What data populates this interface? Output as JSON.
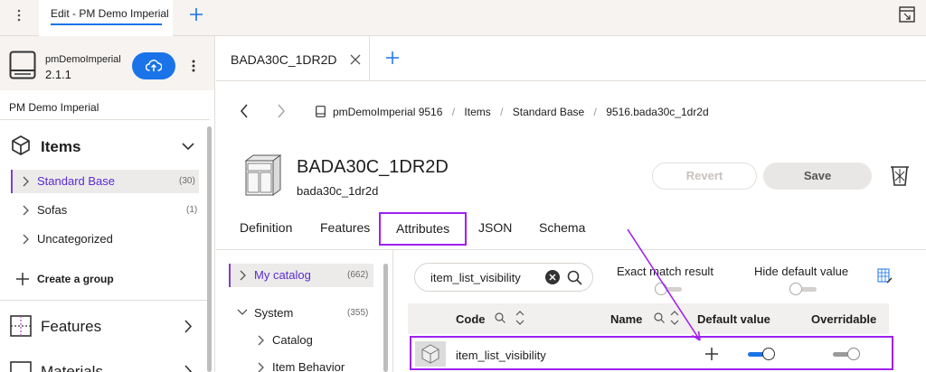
{
  "topbar": {
    "tab_label": "Edit - PM Demo Imperial"
  },
  "project": {
    "name": "pmDemoImperial",
    "version": "2.1.1",
    "title": "PM Demo Imperial"
  },
  "sidebar": {
    "items_heading": "Items",
    "groups": [
      {
        "label": "Standard Base",
        "count": "(30)"
      },
      {
        "label": "Sofas",
        "count": "(1)"
      },
      {
        "label": "Uncategorized",
        "count": ""
      }
    ],
    "create_group": "Create a group",
    "features": "Features",
    "materials": "Materials"
  },
  "main": {
    "tab_label": "BADA30C_1DR2D",
    "breadcrumb": [
      "pmDemoImperial 9516",
      "Items",
      "Standard Base",
      "9516.bada30c_1dr2d"
    ],
    "item_title": "BADA30C_1DR2D",
    "item_subtitle": "bada30c_1dr2d",
    "revert_label": "Revert",
    "save_label": "Save",
    "tabs": [
      "Definition",
      "Features",
      "Attributes",
      "JSON",
      "Schema"
    ]
  },
  "catalog": {
    "my_catalog": "My catalog",
    "my_catalog_count": "(662)",
    "system": "System",
    "system_count": "(355)",
    "children": [
      "Catalog",
      "Item Behavior"
    ]
  },
  "filter": {
    "search_value": "item_list_visibility",
    "exact_match": "Exact match result",
    "hide_default": "Hide default value"
  },
  "table": {
    "headers": {
      "code": "Code",
      "name": "Name",
      "default": "Default value",
      "overridable": "Overridable"
    },
    "rows": [
      {
        "code": "item_list_visibility",
        "name": "",
        "default_toggle": "on",
        "overridable_toggle": "off"
      }
    ]
  },
  "colors": {
    "accent": "#1a73e8",
    "highlight": "#a020f0",
    "selected_bg": "#ecebea"
  }
}
